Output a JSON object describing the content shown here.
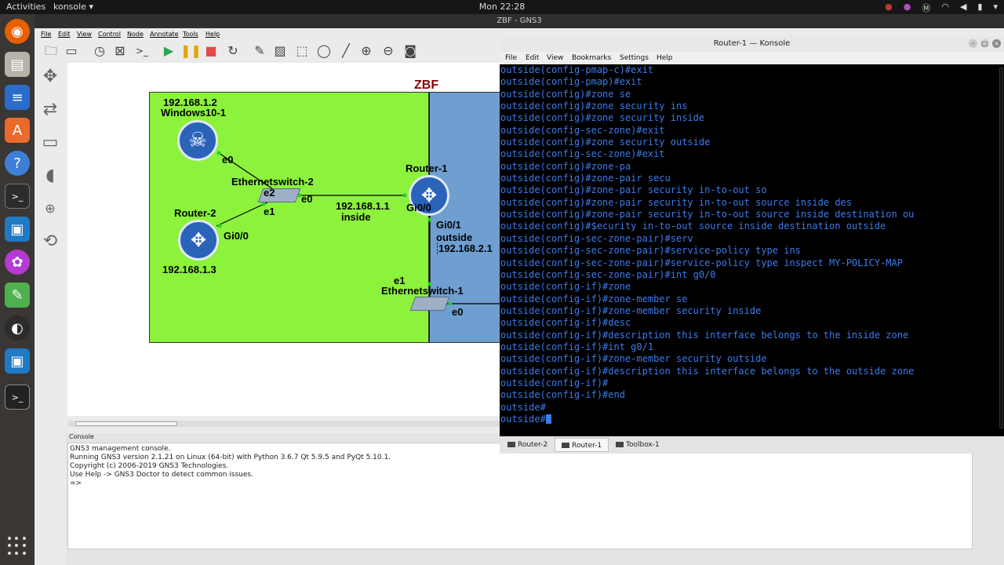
{
  "topbar": {
    "activities": "Activities",
    "app_menu": "konsole ▾",
    "clock": "Mon 22:28"
  },
  "window_title": "ZBF - GNS3",
  "gns3": {
    "menu": [
      "File",
      "Edit",
      "View",
      "Control",
      "Node",
      "Annotate",
      "Tools",
      "Help"
    ],
    "topology": {
      "zone_title": "ZBF",
      "windows_ip": "192.168.1.2",
      "windows_name": "Windows10-1",
      "win_iface": "e0",
      "sw2_name": "Ethernetswitch-2",
      "sw2_e2": "e2",
      "sw2_e0": "e0",
      "sw2_e1": "e1",
      "router2_name": "Router-2",
      "router2_iface": "Gi0/0",
      "router2_ip": "192.168.1.3",
      "router1_name": "Router-1",
      "router1_gi00": "Gi0/0",
      "inside_ip": "192.168.1.1",
      "inside_label": "inside",
      "router1_gi01": "Gi0/1",
      "outside_label": "outside",
      "outside_ip": "192.168.2.1",
      "sw1_e1": "e1",
      "sw1_name": "Ethernetswitch-1",
      "sw1_e0": "e0"
    },
    "console_title": "Console",
    "console_lines": [
      "GNS3 management console.",
      "Running GNS3 version 2.1.21 on Linux (64-bit) with Python 3.6.7 Qt 5.9.5 and PyQt 5.10.1.",
      "Copyright (c) 2006-2019 GNS3 Technologies.",
      "Use Help -> GNS3 Doctor to detect common issues.",
      "",
      "=>"
    ]
  },
  "konsole": {
    "title": "Router-1 — Konsole",
    "menu": [
      "File",
      "Edit",
      "View",
      "Bookmarks",
      "Settings",
      "Help"
    ],
    "lines": [
      "outside(config-pmap-c)#exit",
      "outside(config-pmap)#exit",
      "outside(config)#zone se",
      "outside(config)#zone security ins",
      "outside(config)#zone security inside",
      "outside(config-sec-zone)#exit",
      "outside(config)#zone security outside",
      "outside(config-sec-zone)#exit",
      "outside(config)#zone-pa",
      "outside(config)#zone-pair secu",
      "outside(config)#zone-pair security in-to-out so",
      "outside(config)#zone-pair security in-to-out source inside des",
      "outside(config)#zone-pair security in-to-out source inside destination ou",
      "outside(config)#$ecurity in-to-out source inside destination outside",
      "outside(config-sec-zone-pair)#serv",
      "outside(config-sec-zone-pair)#service-policy type ins",
      "outside(config-sec-zone-pair)#service-policy type inspect MY-POLICY-MAP",
      "outside(config-sec-zone-pair)#int g0/0",
      "outside(config-if)#zone",
      "outside(config-if)#zone-member se",
      "outside(config-if)#zone-member security inside",
      "outside(config-if)#desc",
      "outside(config-if)#description this interface belongs to the inside zone",
      "outside(config-if)#int g0/1",
      "outside(config-if)#zone-member security outside",
      "outside(config-if)#description this interface belongs to the outside zone",
      "outside(config-if)#",
      "outside(config-if)#end",
      "outside#",
      "outside#"
    ],
    "tabs": [
      "Router-2",
      "Router-1",
      "Toolbox-1"
    ],
    "active_tab": "Router-1"
  },
  "colors": {
    "inside_zone": "#8cf23c",
    "outside_zone": "#6f9ed0",
    "zone_title": "#8b0000",
    "terminal_text": "#3c7bea",
    "router_icon": "#2b63b8"
  }
}
